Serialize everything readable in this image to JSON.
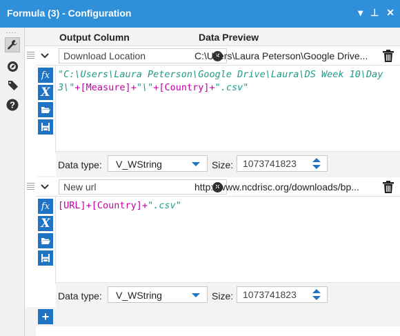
{
  "window": {
    "title": "Formula (3) - Configuration",
    "controls": [
      "▾",
      "⊥",
      "✕"
    ]
  },
  "toolbar": {
    "grip": "....",
    "tools": [
      "wrench-icon",
      "compass-icon",
      "tag-icon",
      "help-icon"
    ],
    "selected": "wrench-icon"
  },
  "columns": {
    "output": "Output Column",
    "preview": "Data Preview"
  },
  "formulas": [
    {
      "output_column": "Download Location",
      "preview": "C:\\Users\\Laura Peterson\\Google Drive...",
      "expression_parts": [
        {
          "t": "str",
          "v": "\"C:\\Users\\Laura Peterson\\Google Drive\\Laura\\DS Week 10\\Day 3\\\""
        },
        {
          "t": "op",
          "v": "+"
        },
        {
          "t": "fld",
          "v": "[Measure]"
        },
        {
          "t": "op",
          "v": "+"
        },
        {
          "t": "str",
          "v": "\"\\\""
        },
        {
          "t": "op",
          "v": "+"
        },
        {
          "t": "fld",
          "v": "[Country]"
        },
        {
          "t": "op",
          "v": "+"
        },
        {
          "t": "str",
          "v": "\".csv\""
        }
      ],
      "data_type_label": "Data type:",
      "data_type": "V_WString",
      "size_label": "Size:",
      "size": "1073741823"
    },
    {
      "output_column": "New url",
      "preview": "http://www.ncdrisc.org/downloads/bp...",
      "expression_parts": [
        {
          "t": "fld",
          "v": "[URL]"
        },
        {
          "t": "op",
          "v": "+"
        },
        {
          "t": "fld",
          "v": "[Country]"
        },
        {
          "t": "op",
          "v": "+"
        },
        {
          "t": "str",
          "v": "\".csv\""
        }
      ],
      "data_type_label": "Data type:",
      "data_type": "V_WString",
      "size_label": "Size:",
      "size": "1073741823"
    }
  ],
  "formula_buttons": {
    "fx": "fx",
    "variable": "X",
    "open": "folder-open-icon",
    "save": "save-icon"
  },
  "add_button": "+",
  "colors": {
    "titlebar": "#2f8fd8",
    "button": "#1e73c2",
    "string": "#209a88",
    "field": "#c200a4"
  }
}
